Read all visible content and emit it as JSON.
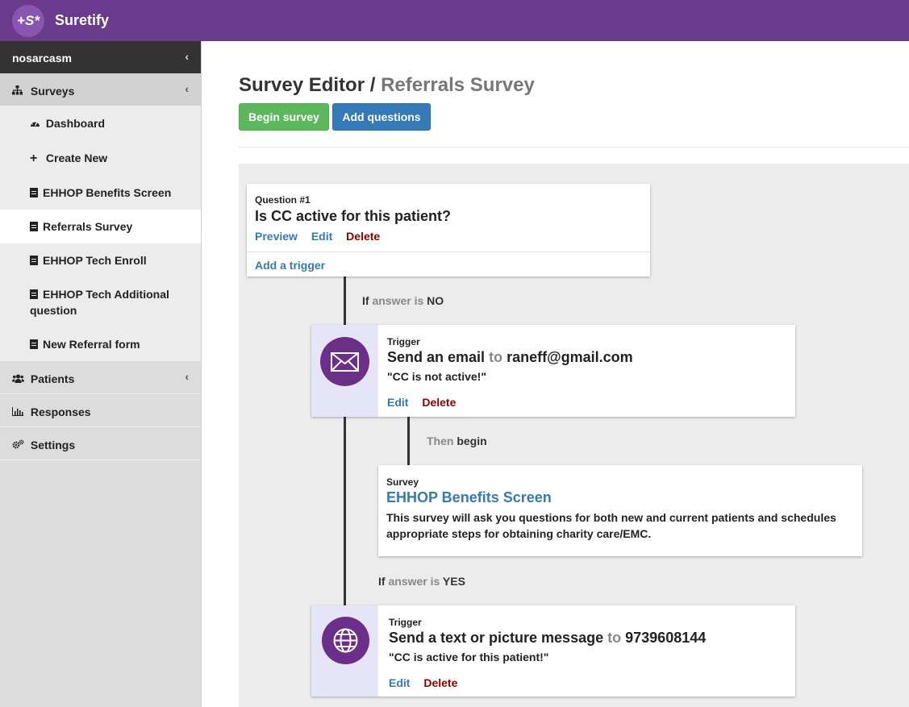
{
  "app": {
    "logo_text": "+S*",
    "name": "Suretify"
  },
  "sidebar": {
    "user": "nosarcasm",
    "surveys": {
      "label": "Surveys",
      "items": [
        {
          "label": "Dashboard"
        },
        {
          "label": "Create New"
        },
        {
          "label": "EHHOP Benefits Screen"
        },
        {
          "label": "Referrals Survey"
        },
        {
          "label": "EHHOP Tech Enroll"
        },
        {
          "label": "EHHOP Tech Additional question"
        },
        {
          "label": "New Referral form"
        }
      ]
    },
    "patients": {
      "label": "Patients"
    },
    "responses": {
      "label": "Responses"
    },
    "settings": {
      "label": "Settings"
    }
  },
  "header": {
    "title": "Survey Editor /",
    "subtitle": "Referrals Survey",
    "begin_label": "Begin survey",
    "add_label": "Add questions"
  },
  "question": {
    "number": "Question #1",
    "text": "Is CC active for this patient?",
    "preview": "Preview",
    "edit": "Edit",
    "delete": "Delete",
    "add_trigger": "Add a trigger"
  },
  "branch_no": {
    "prefix": "If",
    "mid": "answer is",
    "value": "NO"
  },
  "trigger_email": {
    "label": "Trigger",
    "action": "Send an email",
    "to": "to",
    "target": "raneff@gmail.com",
    "message": "\"CC is not active!\"",
    "edit": "Edit",
    "delete": "Delete"
  },
  "then_begin": {
    "mute": "Then",
    "rest": "begin"
  },
  "survey_card": {
    "label": "Survey",
    "title": "EHHOP Benefits Screen",
    "description": "This survey will ask you questions for both new and current patients and schedules appropriate steps for obtaining charity care/EMC."
  },
  "branch_yes": {
    "prefix": "If",
    "mid": "answer is",
    "value": "YES"
  },
  "trigger_text": {
    "label": "Trigger",
    "action": "Send a text or picture message",
    "to": "to",
    "target": "9739608144",
    "message": "\"CC is active for this patient!\"",
    "edit": "Edit",
    "delete": "Delete"
  },
  "colors": {
    "brand": "#6a3a8c",
    "green": "#5cb85c",
    "blue": "#337ab7",
    "danger": "#8b0000"
  }
}
